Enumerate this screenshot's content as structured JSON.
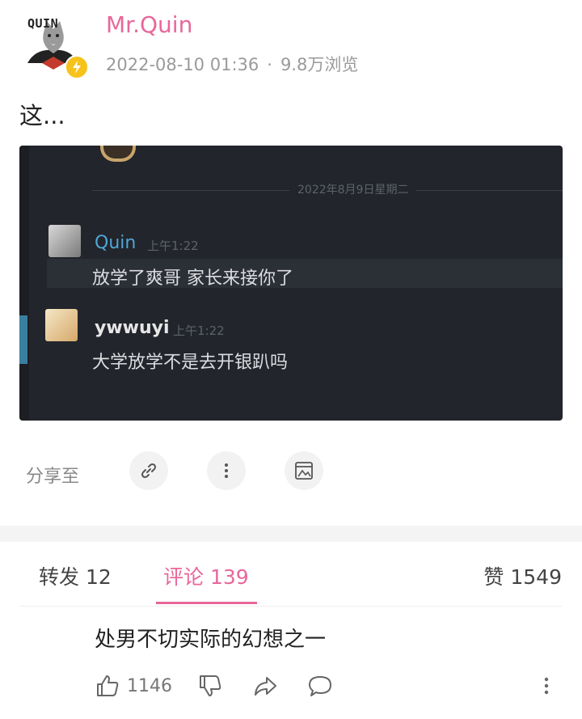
{
  "post": {
    "author": "Mr.Quin",
    "avatar_logo_text": "QUIN",
    "date": "2022-08-10 01:36",
    "separator": "·",
    "views": "9.8万浏览",
    "text": "这..."
  },
  "screenshot": {
    "date_divider": "2022年8月9日星期二",
    "messages": [
      {
        "user": "Quin",
        "time": "上午1:22",
        "text": "放学了爽哥 家长来接你了",
        "user_color": "#4fa7d6"
      },
      {
        "user": "ywwuyi",
        "time": "上午1:22",
        "text": "大学放学不是去开银趴吗",
        "user_color": "#e6e6e6"
      }
    ]
  },
  "share": {
    "label": "分享至",
    "icons": [
      "link-icon",
      "more-vertical-icon",
      "image-save-icon"
    ]
  },
  "tabs": [
    {
      "label": "转发 12",
      "active": false
    },
    {
      "label": "评论 139",
      "active": true
    },
    {
      "label": "赞 1549",
      "active": false
    }
  ],
  "comment": {
    "text": "处男不切实际的幻想之一",
    "likes": "1146"
  },
  "colors": {
    "accent": "#e8679a",
    "muted": "#9a9a9a",
    "chat_bg": "#22252b"
  }
}
